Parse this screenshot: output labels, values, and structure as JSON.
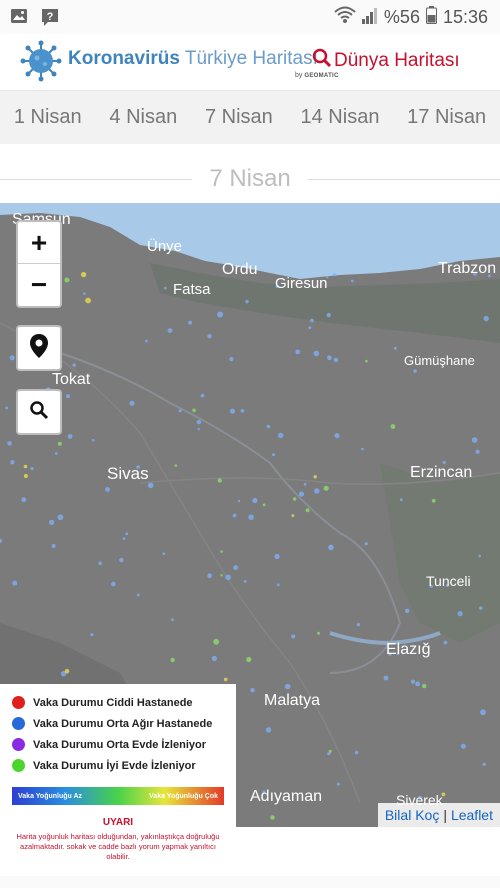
{
  "status_bar": {
    "battery": "%56",
    "time": "15:36",
    "icons": [
      "image-icon",
      "help-icon",
      "wifi-icon",
      "signal-icon",
      "battery-icon"
    ]
  },
  "header": {
    "brand_bold": "Koronavirüs",
    "brand_rest": "Türkiye Haritası",
    "byline_by": "by",
    "byline_company": "GEOMATIC",
    "world_map_label": "Dünya Haritası"
  },
  "date_tabs": [
    "1 Nisan",
    "4 Nisan",
    "7 Nisan",
    "14 Nisan",
    "17 Nisan"
  ],
  "selected_date": "7 Nisan",
  "map": {
    "zoom_in": "+",
    "zoom_out": "−",
    "cities": [
      "Samsun",
      "Ünye",
      "Ordu",
      "Fatsa",
      "Giresun",
      "Trabzon",
      "Gümüşhane",
      "Tokat",
      "Sivas",
      "Erzincan",
      "Tunceli",
      "Elazığ",
      "Malatya",
      "Adıyaman",
      "Siverek"
    ],
    "attribution_author": "Bilal Koç",
    "attribution_separator": "|",
    "attribution_lib": "Leaflet"
  },
  "legend": {
    "items": [
      {
        "label": "Vaka Durumu Ciddi Hastanede",
        "color": "#e0201a"
      },
      {
        "label": "Vaka Durumu Orta Ağır Hastanede",
        "color": "#2868d8"
      },
      {
        "label": "Vaka Durumu Orta Evde İzleniyor",
        "color": "#8a2be2"
      },
      {
        "label": "Vaka Durumu İyi Evde İzleniyor",
        "color": "#4ad52f"
      }
    ],
    "density_low": "Vaka Yoğunluğu Az",
    "density_high": "Vaka Yoğunluğu Çok",
    "warning_title": "UYARI",
    "warning_text": "Harita yoğunluk haritası olduğundan, yakınlaştıkça doğruluğu azalmaktadır. sokak ve cadde bazlı yorum yapmak yanıltıcı olabilir."
  },
  "colors": {
    "brand_blue": "#3f84bd",
    "accent_red": "#c8102e",
    "sea": "#a9c9e8",
    "land": "#7a7a7a"
  }
}
